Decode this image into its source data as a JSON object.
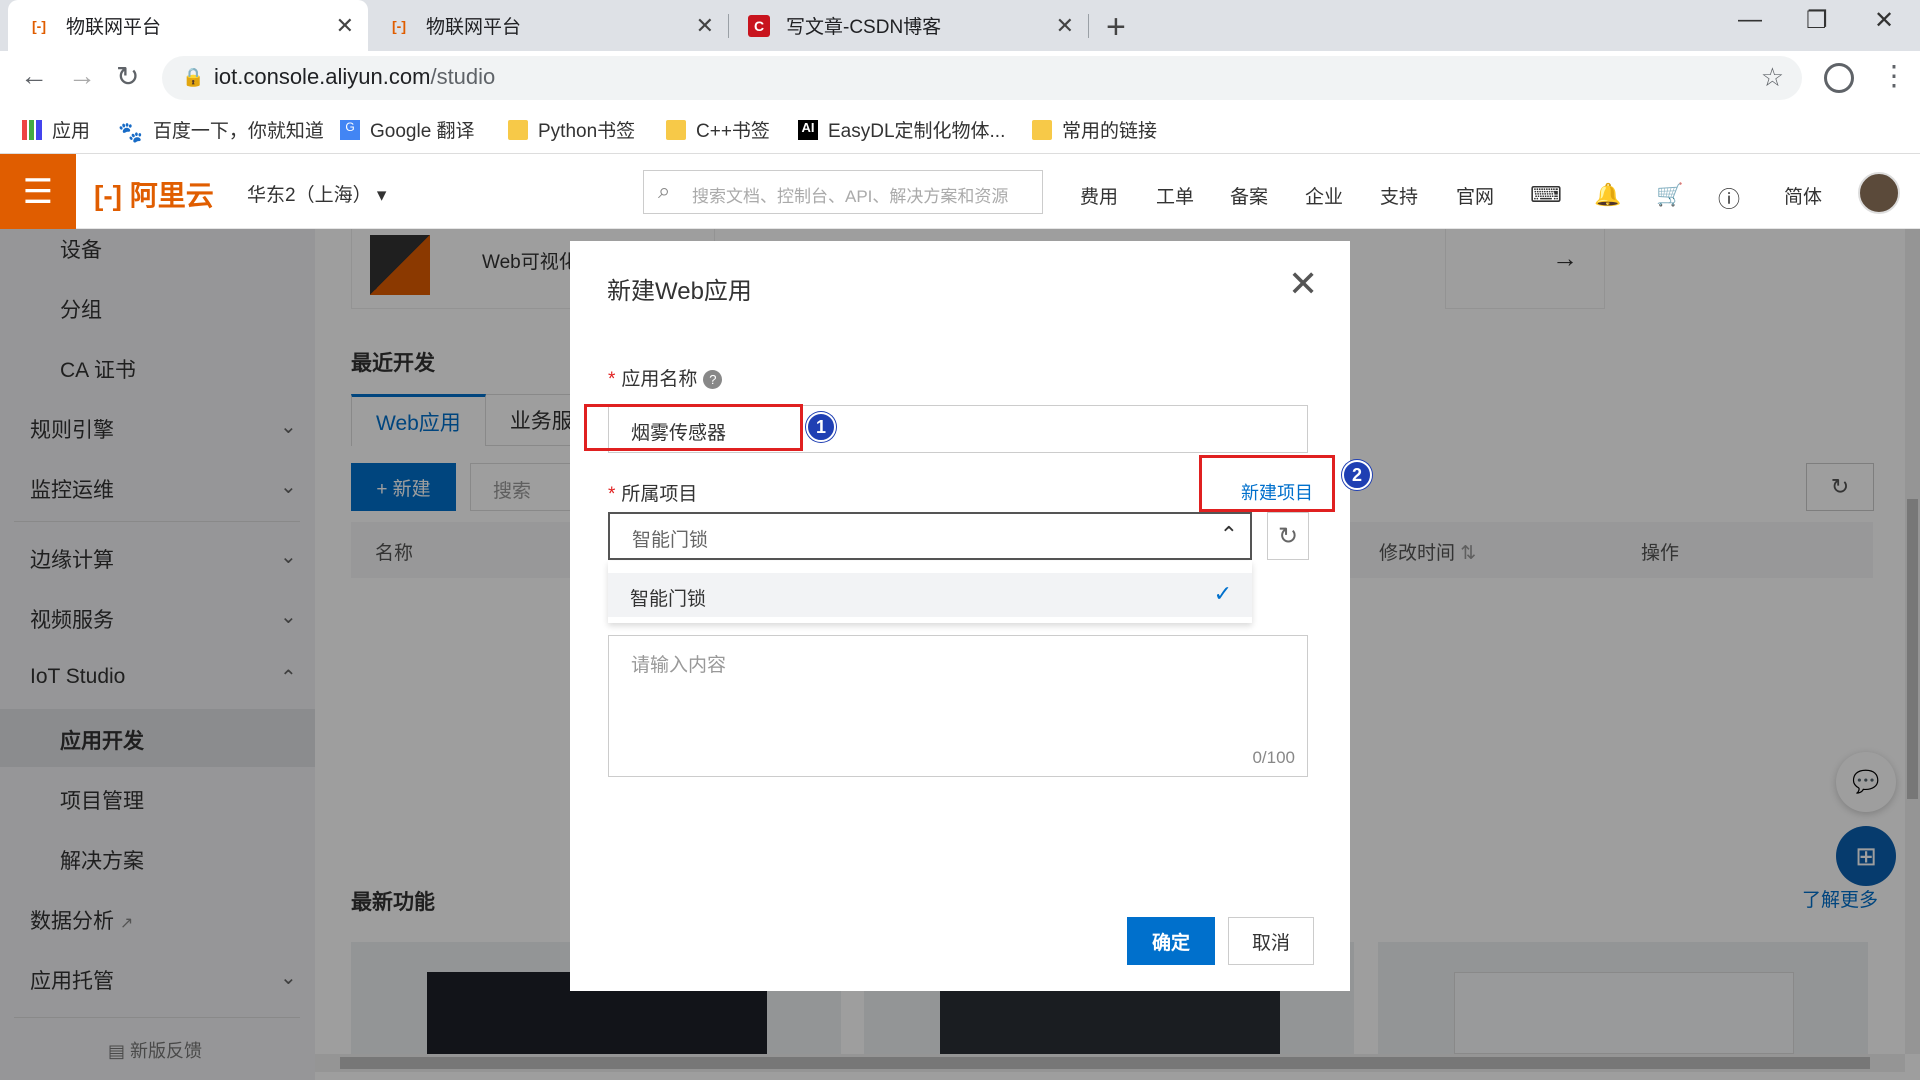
{
  "browser": {
    "tabs": [
      {
        "title": "物联网平台",
        "active": true
      },
      {
        "title": "物联网平台",
        "active": false
      },
      {
        "title": "写文章-CSDN博客",
        "active": false
      }
    ],
    "url_host": "iot.console.aliyun.com",
    "url_path": "/studio",
    "bookmarks": [
      "应用",
      "百度一下，你就知道",
      "Google 翻译",
      "Python书签",
      "C++书签",
      "EasyDL定制化物体...",
      "常用的链接"
    ]
  },
  "header": {
    "logo": "阿里云",
    "region": "华东2（上海）",
    "search_placeholder": "搜索文档、控制台、API、解决方案和资源",
    "nav": [
      "费用",
      "工单",
      "备案",
      "企业",
      "支持",
      "官网",
      "简体"
    ]
  },
  "sidebar": {
    "items": [
      {
        "label": "设备",
        "sub": true
      },
      {
        "label": "分组",
        "sub": true
      },
      {
        "label": "CA 证书",
        "sub": true
      },
      {
        "label": "规则引擎",
        "sub": false,
        "expandable": true
      },
      {
        "label": "监控运维",
        "sub": false,
        "expandable": true
      },
      {
        "label": "边缘计算",
        "sub": false,
        "expandable": true
      },
      {
        "label": "视频服务",
        "sub": false,
        "expandable": true
      },
      {
        "label": "IoT Studio",
        "sub": false,
        "expanded": true
      },
      {
        "label": "应用开发",
        "sub": true,
        "active": true
      },
      {
        "label": "项目管理",
        "sub": true
      },
      {
        "label": "解决方案",
        "sub": true
      },
      {
        "label": "数据分析",
        "sub": false
      },
      {
        "label": "应用托管",
        "sub": false,
        "expandable": true
      }
    ],
    "feedback": "新版反馈"
  },
  "main": {
    "card1_text": "Web可视化开",
    "recent_title": "最近开发",
    "tabs": [
      "Web应用",
      "业务服"
    ],
    "new_button": "+ 新建",
    "search_placeholder": "搜索",
    "columns": [
      "名称",
      "修改时间",
      "操作"
    ],
    "latest_title": "最新功能",
    "learn_more": "了解更多"
  },
  "modal": {
    "title": "新建Web应用",
    "name_label": "应用名称",
    "name_value": "烟雾传感器",
    "project_label": "所属项目",
    "new_project_link": "新建项目",
    "project_selected": "智能门锁",
    "dropdown_options": [
      "智能门锁"
    ],
    "desc_placeholder": "请输入内容",
    "desc_count": "0/100",
    "ok_button": "确定",
    "cancel_button": "取消"
  },
  "annotations": {
    "badge1": "1",
    "badge2": "2"
  },
  "colors": {
    "brand": "#e05d00",
    "primary": "#0070cc",
    "annotation_red": "#e02020",
    "badge_blue": "#1f3fb3"
  }
}
